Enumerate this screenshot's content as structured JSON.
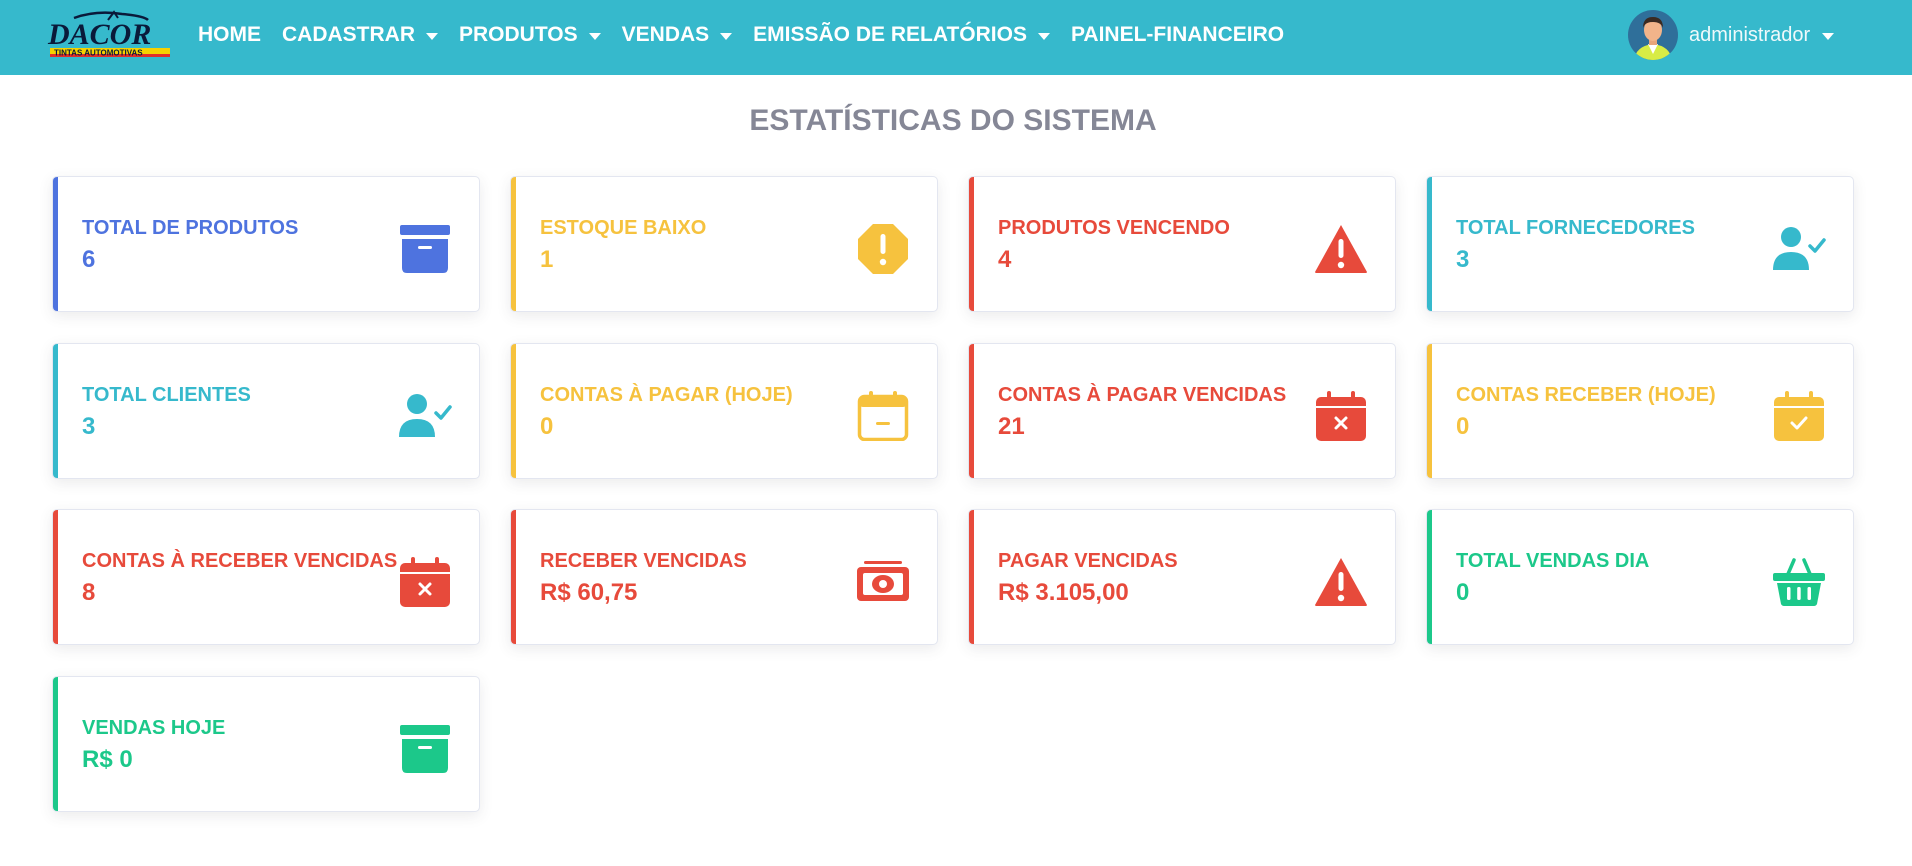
{
  "navbar": {
    "logo": {
      "brand": "DACOR",
      "tagline": "TINTAS AUTOMOTIVAS"
    },
    "items": [
      {
        "label": "HOME",
        "dropdown": false
      },
      {
        "label": "CADASTRAR",
        "dropdown": true
      },
      {
        "label": "PRODUTOS",
        "dropdown": true
      },
      {
        "label": "VENDAS",
        "dropdown": true
      },
      {
        "label": "EMISSÃO DE RELATÓRIOS",
        "dropdown": true
      },
      {
        "label": "PAINEL-FINANCEIRO",
        "dropdown": false
      }
    ],
    "user": {
      "name": "administrador"
    }
  },
  "page_title": "ESTATÍSTICAS DO SISTEMA",
  "cards": [
    {
      "label": "TOTAL DE PRODUTOS",
      "value": "6",
      "color": "#4e73df",
      "icon": "archive-box-icon"
    },
    {
      "label": "ESTOQUE BAIXO",
      "value": "1",
      "color": "#f6c23e",
      "icon": "exclamation-octagon-icon"
    },
    {
      "label": "PRODUTOS VENCENDO",
      "value": "4",
      "color": "#e74a3b",
      "icon": "warning-triangle-icon"
    },
    {
      "label": "TOTAL FORNECEDORES",
      "value": "3",
      "color": "#36b9cc",
      "icon": "user-check-icon"
    },
    {
      "label": "TOTAL CLIENTES",
      "value": "3",
      "color": "#36b9cc",
      "icon": "user-check-icon"
    },
    {
      "label": "CONTAS À PAGAR (HOJE)",
      "value": "0",
      "color": "#f6c23e",
      "icon": "calendar-minus-icon"
    },
    {
      "label": "CONTAS À PAGAR VENCIDAS",
      "value": "21",
      "color": "#e74a3b",
      "icon": "calendar-times-icon"
    },
    {
      "label": "CONTAS RECEBER (HOJE)",
      "value": "0",
      "color": "#f6c23e",
      "icon": "calendar-check-icon"
    },
    {
      "label": "CONTAS À RECEBER VENCIDAS",
      "value": "8",
      "color": "#e74a3b",
      "icon": "calendar-times-icon"
    },
    {
      "label": "RECEBER VENCIDAS",
      "value": "R$ 60,75",
      "color": "#e74a3b",
      "icon": "money-bill-icon"
    },
    {
      "label": "PAGAR VENCIDAS",
      "value": "R$ 3.105,00",
      "color": "#e74a3b",
      "icon": "warning-triangle-icon"
    },
    {
      "label": "TOTAL VENDAS DIA",
      "value": "0",
      "color": "#1cc88a",
      "icon": "shopping-basket-icon"
    },
    {
      "label": "VENDAS HOJE",
      "value": "R$ 0",
      "color": "#1cc88a",
      "icon": "archive-box-icon"
    }
  ]
}
